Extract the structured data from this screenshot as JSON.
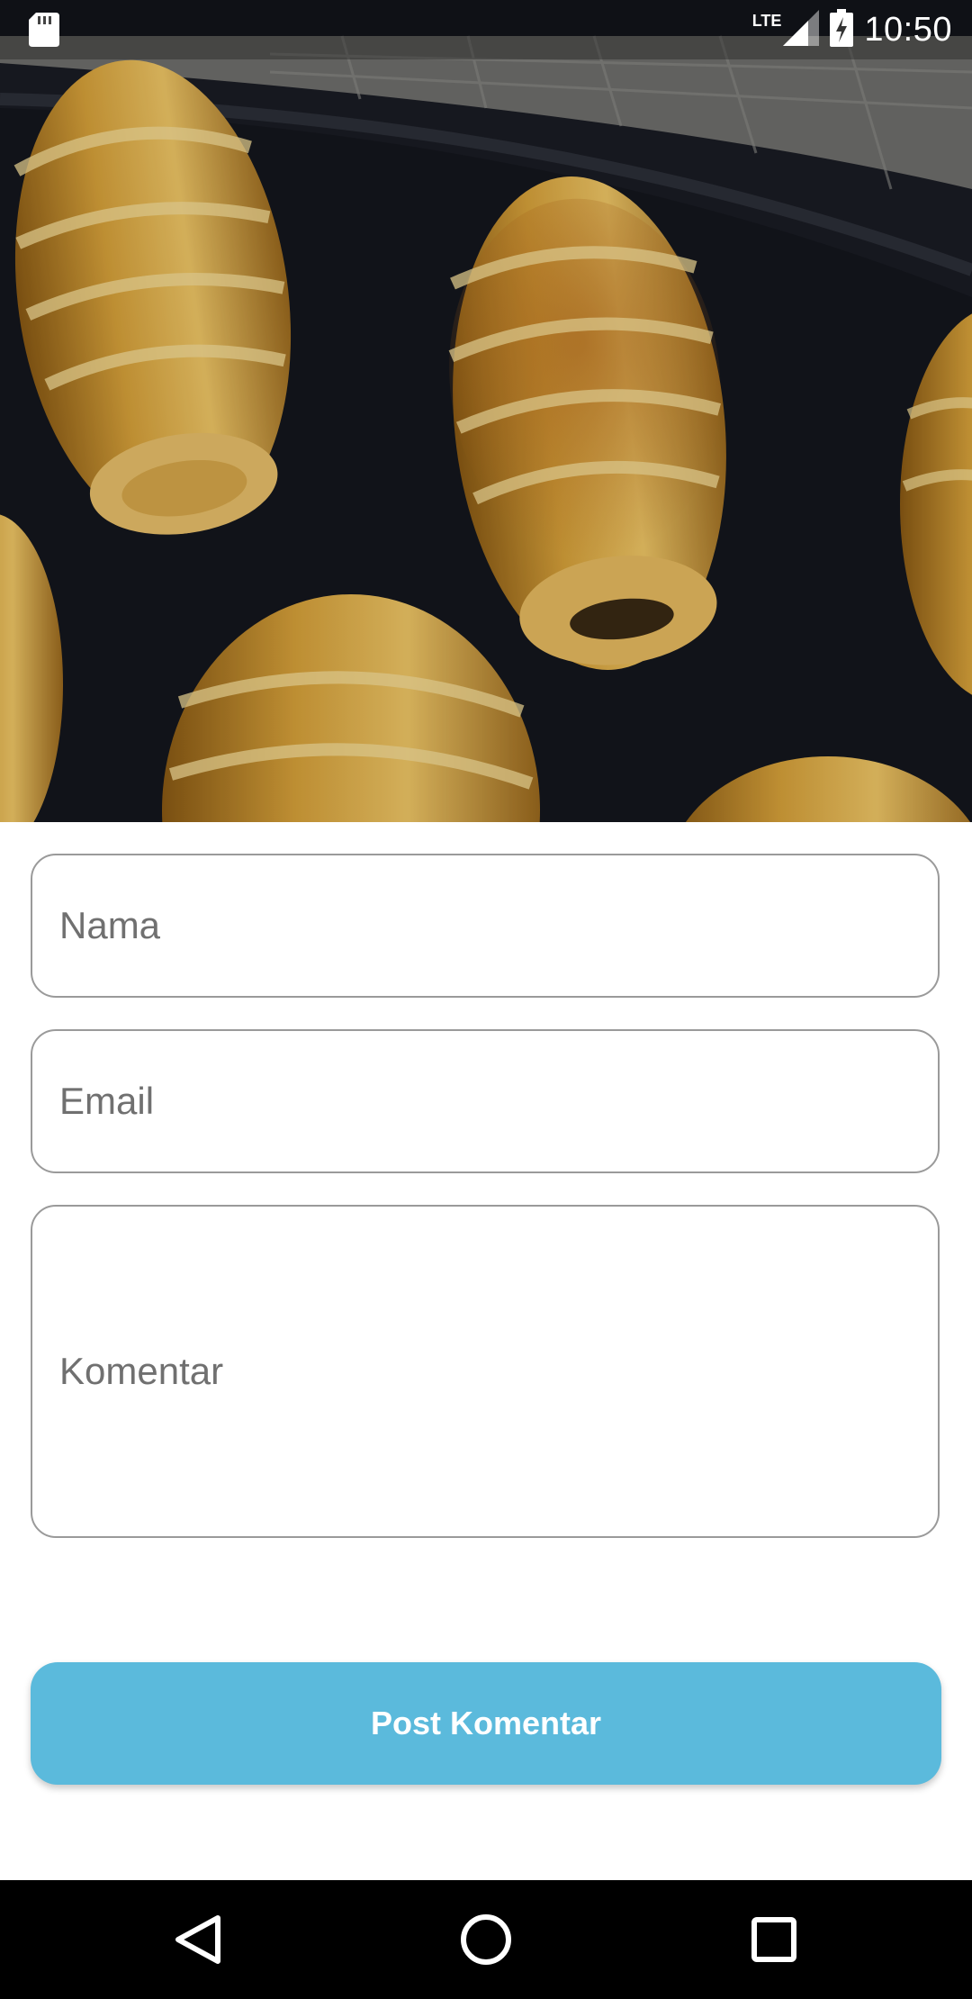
{
  "status_bar": {
    "time": "10:50",
    "network": "LTE",
    "icons": [
      "sd-card-icon",
      "signal-icon",
      "battery-charging-icon"
    ]
  },
  "hero": {
    "image": "baked-bread-rolls-photo"
  },
  "form": {
    "nama_placeholder": "Nama",
    "nama_value": "",
    "email_placeholder": "Email",
    "email_value": "",
    "komentar_placeholder": "Komentar",
    "komentar_value": "",
    "submit_label": "Post Komentar"
  },
  "colors": {
    "accent": "#5bbadc",
    "field_border": "#9a9a9a",
    "navbar": "#000000"
  },
  "nav_bar": {
    "icons": [
      "back-icon",
      "home-icon",
      "recents-icon"
    ]
  }
}
